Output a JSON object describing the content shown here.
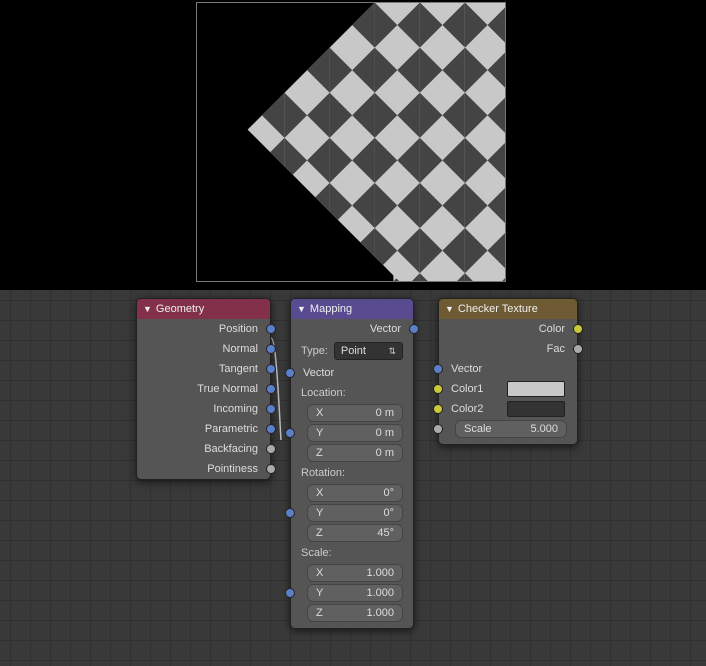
{
  "viewport": {
    "pattern": "diagonal-checker"
  },
  "nodes": {
    "geometry": {
      "title": "Geometry",
      "outputs": [
        "Position",
        "Normal",
        "Tangent",
        "True Normal",
        "Incoming",
        "Parametric",
        "Backfacing",
        "Pointiness"
      ]
    },
    "mapping": {
      "title": "Mapping",
      "output": "Vector",
      "type_label": "Type:",
      "type_value": "Point",
      "vector_label": "Vector",
      "sections": {
        "location": {
          "label": "Location:",
          "X": "0 m",
          "Y": "0 m",
          "Z": "0 m"
        },
        "rotation": {
          "label": "Rotation:",
          "X": "0°",
          "Y": "0°",
          "Z": "45°"
        },
        "scale": {
          "label": "Scale:",
          "X": "1.000",
          "Y": "1.000",
          "Z": "1.000"
        }
      }
    },
    "checker": {
      "title": "Checker Texture",
      "out_color": "Color",
      "out_fac": "Fac",
      "in_vector": "Vector",
      "in_color1": "Color1",
      "in_color2": "Color2",
      "scale_label": "Scale",
      "scale_value": "5.000"
    }
  }
}
